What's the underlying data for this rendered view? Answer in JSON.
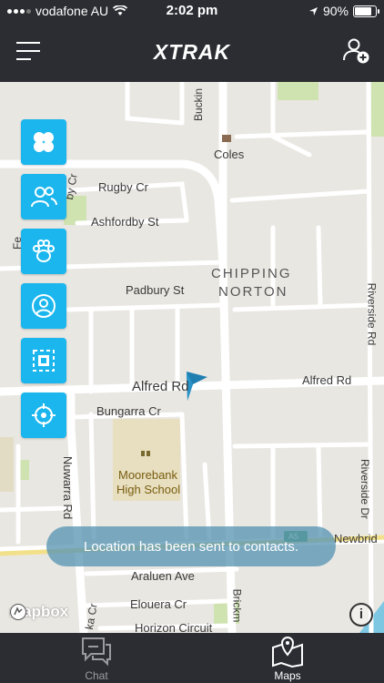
{
  "status": {
    "carrier": "vodafone AU",
    "time": "2:02 pm",
    "battery": "90%",
    "battery_level": 0.9
  },
  "header": {
    "logo": "XTRAK",
    "menu_icon": "hamburger-menu-icon",
    "add_icon": "add-user-icon"
  },
  "map": {
    "labels": {
      "coles": "Coles",
      "rugby": "Rugby Cr",
      "ashfordby": "Ashfordby St",
      "padbury": "Padbury St",
      "chipping": "CHIPPING",
      "norton": "NORTON",
      "alfred_left": "Alfred Rd",
      "alfred_right": "Alfred Rd",
      "bungarra": "Bungarra Cr",
      "school1": "Moorebank",
      "school2": "High School",
      "nuwarra": "Nuwarra Rd",
      "riverside1": "Riverside Rd",
      "riverside2": "Riverside Dr",
      "newbrid": "Newbrid",
      "araluen": "Araluen Ave",
      "elouera": "Elouera Cr",
      "horizon": "Horizon Circuit",
      "buckin": "Buckin",
      "brickm": "Brickm",
      "by_cr": "by Cr",
      "fe": "Fe",
      "rparka": "ka Cr",
      "a_shield": "A5"
    },
    "attribution": "mapbox",
    "info": "i"
  },
  "fab_icons": [
    "clover-icon",
    "users-icon",
    "paw-icon",
    "location-pin-icon",
    "fence-icon",
    "crosshair-icon"
  ],
  "toast": "Location has been sent to contacts.",
  "tabs": [
    {
      "label": "Chat",
      "icon": "chat-icon",
      "active": false
    },
    {
      "label": "Maps",
      "icon": "map-icon",
      "active": true
    }
  ],
  "colors": {
    "accent": "#1ab6ed",
    "bar": "#2c2d33",
    "map_bg": "#e9e7e2",
    "inactive_tab": "#9a9aa0"
  }
}
